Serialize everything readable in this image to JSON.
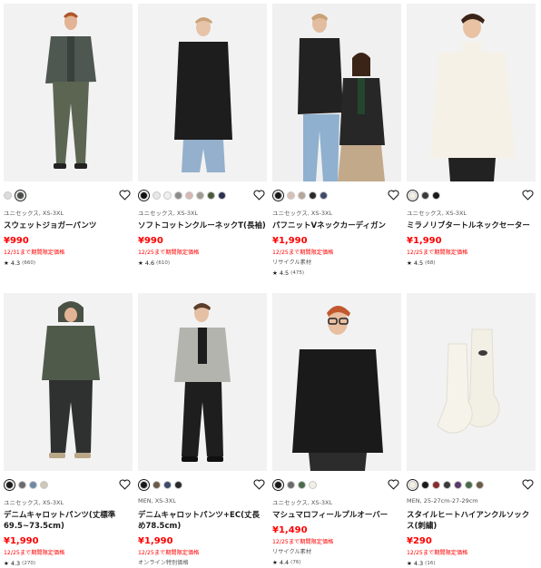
{
  "products": [
    {
      "colors": [
        "#dcdcdc",
        "#4a4f4a"
      ],
      "selected": 1,
      "meta": "ユニセックス, XS-3XL",
      "name": "スウェットジョガーパンツ",
      "price": "¥990",
      "promo": "12/31まで期間限定価格",
      "extra": "",
      "rating": "4.3",
      "reviews": "(660)",
      "image": "man-in-grey-jacket-and-olive-jogger-pants"
    },
    {
      "colors": [
        "#111111",
        "#e8e8e8",
        "#f0f0f0",
        "#8c8c8c",
        "#d7b7b7",
        "#a09c92",
        "#4c5a3c",
        "#2a3152"
      ],
      "selected": 0,
      "meta": "ユニセックス, XS-3XL",
      "name": "ソフトコットンクルーネックT(長袖)",
      "price": "¥990",
      "promo": "12/25まで期間限定価格",
      "extra": "",
      "rating": "4.6",
      "reviews": "(610)",
      "image": "man-in-black-long-sleeve-tee"
    },
    {
      "colors": [
        "#1a1a1a",
        "#d9c0b6",
        "#b4a79a",
        "#2a2a2a",
        "#3f4a6b"
      ],
      "selected": 0,
      "meta": "ユニセックス, XS-3XL",
      "name": "パフニットVネックカーディガン",
      "price": "¥1,990",
      "promo": "12/25まで期間限定価格",
      "extra": "リサイクル素材",
      "rating": "4.5",
      "reviews": "(475)",
      "image": "two-models-in-black-knit-cardigans"
    },
    {
      "colors": [
        "#f3efe4",
        "#3a3a3a",
        "#1a1a1a"
      ],
      "selected": 0,
      "meta": "ユニセックス, XS-3XL",
      "name": "ミラノリブタートルネックセーター",
      "price": "¥1,990",
      "promo": "12/25まで期間限定価格",
      "extra": "",
      "rating": "4.5",
      "reviews": "(68)",
      "image": "man-in-cream-turtleneck-sweater"
    },
    {
      "colors": [
        "#1a1a1a",
        "#6b6b6b",
        "#6e8aa5",
        "#cfc7b8"
      ],
      "selected": 0,
      "meta": "ユニセックス, XS-3XL",
      "name": "デニムキャロットパンツ(丈標準69.5~73.5cm)",
      "price": "¥1,990",
      "promo": "12/25まで期間限定価格",
      "extra": "",
      "rating": "4.3",
      "reviews": "(270)",
      "image": "man-in-khaki-hooded-jacket-and-dark-pants"
    },
    {
      "colors": [
        "#1a1a1a",
        "#6b5a47",
        "#3f4a6b",
        "#2a2a2a"
      ],
      "selected": 0,
      "meta": "MEN, XS-3XL",
      "name": "デニムキャロットパンツ+EC(丈長め78.5cm)",
      "price": "¥1,990",
      "promo": "12/25まで期間限定価格",
      "extra": "オンライン特別価格",
      "rating": "",
      "reviews": "",
      "image": "man-in-grey-blouson-and-black-pants"
    },
    {
      "colors": [
        "#1a1a1a",
        "#6a6a6a",
        "#4a6b4a",
        "#f3efe4"
      ],
      "selected": 0,
      "meta": "ユニセックス, XS-3XL",
      "name": "マシュマロフィールプルオーバー",
      "price": "¥1,490",
      "promo": "12/25まで期間限定価格",
      "extra": "リサイクル素材",
      "rating": "4.4",
      "reviews": "(76)",
      "image": "man-with-glasses-in-black-pullover"
    },
    {
      "colors": [
        "#f3efe4",
        "#1a1a1a",
        "#8b2a2a",
        "#3a3a3a",
        "#5a3a6a",
        "#4a6b4a",
        "#6b5a47"
      ],
      "selected": 0,
      "meta": "MEN, 25-27cm-27-29cm",
      "name": "スタイルヒートハイアンクルソックス(刺繍)",
      "price": "¥290",
      "promo": "12/25まで期間限定価格",
      "extra": "",
      "rating": "4.3",
      "reviews": "(16)",
      "image": "pair-of-cream-high-ankle-socks"
    }
  ]
}
